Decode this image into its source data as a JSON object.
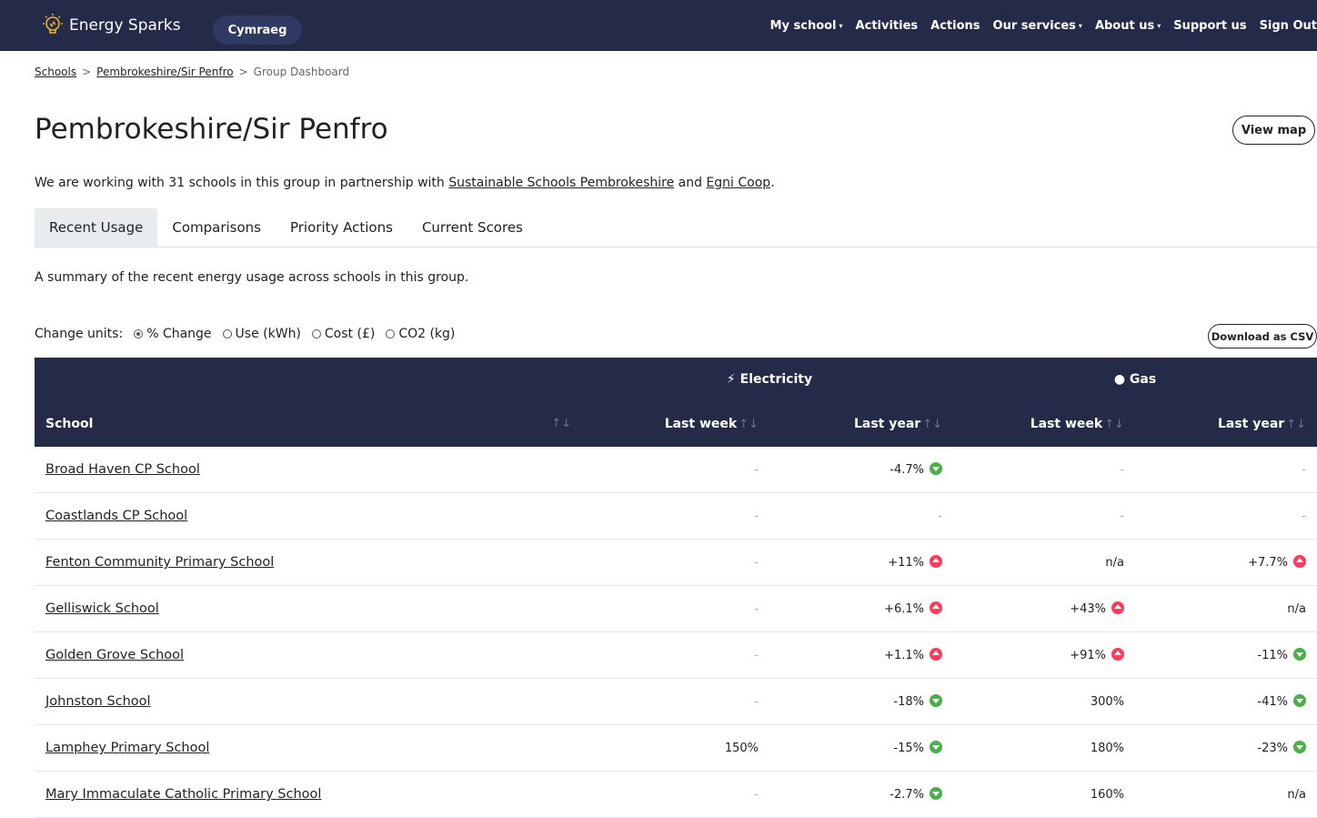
{
  "nav": {
    "brand": "Energy Sparks",
    "language": "Cymraeg",
    "links": [
      {
        "label": "My school",
        "caret": true
      },
      {
        "label": "Activities",
        "caret": false
      },
      {
        "label": "Actions",
        "caret": false
      },
      {
        "label": "Our services",
        "caret": true
      },
      {
        "label": "About us",
        "caret": true
      },
      {
        "label": "Support us",
        "caret": false
      },
      {
        "label": "Sign Out",
        "caret": false
      }
    ]
  },
  "breadcrumb": [
    "Schools",
    "Pembrokeshire/Sir Penfro",
    "Group Dashboard"
  ],
  "page": {
    "title": "Pembrokeshire/Sir Penfro",
    "view_map": "View map",
    "intro_prefix": "We are working with 31 schools in this group in partnership with ",
    "partner_1": "Sustainable Schools Pembrokeshire",
    "intro_and": " and ",
    "partner_2": "Egni Coop",
    "intro_suffix": "."
  },
  "tabs": [
    "Recent Usage",
    "Comparisons",
    "Priority Actions",
    "Current Scores"
  ],
  "summary": "A summary of the recent energy usage across schools in this group.",
  "units": {
    "label": "Change units:",
    "options": [
      {
        "label": "% Change",
        "checked": true
      },
      {
        "label": "Use (kWh)",
        "checked": false
      },
      {
        "label": "Cost (£)",
        "checked": false
      },
      {
        "label": "CO2 (kg)",
        "checked": false
      }
    ]
  },
  "download_csv": "Download as CSV",
  "table": {
    "groups": {
      "electricity": "Electricity",
      "gas": "Gas"
    },
    "headers": {
      "school": "School",
      "last_week": "Last week",
      "last_year": "Last year"
    },
    "rows": [
      {
        "school": "Broad Haven CP School",
        "e_week": "-",
        "e_year": "-4.7%",
        "e_year_dir": "down",
        "g_week": "-",
        "g_year": "-"
      },
      {
        "school": "Coastlands CP School",
        "e_week": "-",
        "e_year": "-",
        "g_week": "-",
        "g_year": "-"
      },
      {
        "school": "Fenton Community Primary School",
        "e_week": "-",
        "e_year": "+11%",
        "e_year_dir": "up",
        "g_week": "n/a",
        "g_year": "+7.7%",
        "g_year_dir": "up"
      },
      {
        "school": "Gelliswick School",
        "e_week": "-",
        "e_year": "+6.1%",
        "e_year_dir": "up",
        "g_week": "+43%",
        "g_week_dir": "up",
        "g_year": "n/a"
      },
      {
        "school": "Golden Grove School",
        "e_week": "-",
        "e_year": "+1.1%",
        "e_year_dir": "up",
        "g_week": "+91%",
        "g_week_dir": "up",
        "g_year": "-11%",
        "g_year_dir": "down"
      },
      {
        "school": "Johnston School",
        "e_week": "-",
        "e_year": "-18%",
        "e_year_dir": "down",
        "g_week": "300%",
        "g_year": "-41%",
        "g_year_dir": "down"
      },
      {
        "school": "Lamphey Primary School",
        "e_week": "150%",
        "e_year": "-15%",
        "e_year_dir": "down",
        "g_week": "180%",
        "g_year": "-23%",
        "g_year_dir": "down"
      },
      {
        "school": "Mary Immaculate Catholic Primary School",
        "e_week": "-",
        "e_year": "-2.7%",
        "e_year_dir": "down",
        "g_week": "160%",
        "g_year": "n/a"
      }
    ]
  },
  "colors": {
    "navbar": "#232b49",
    "up": "#ff3a5c",
    "down": "#4bb04a"
  }
}
